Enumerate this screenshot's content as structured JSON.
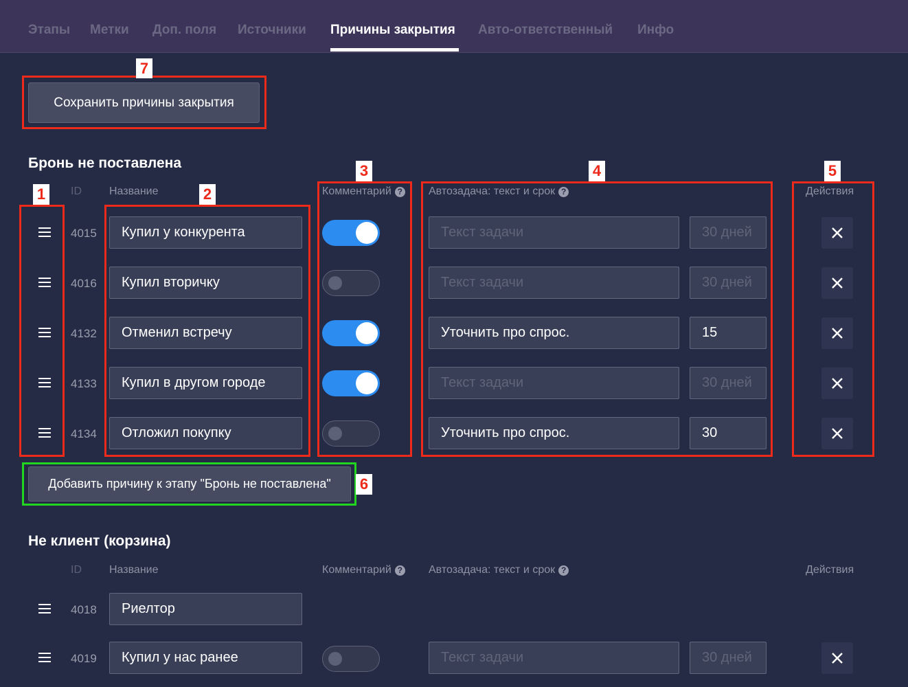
{
  "tabs": [
    {
      "label": "Этапы"
    },
    {
      "label": "Метки"
    },
    {
      "label": "Доп. поля"
    },
    {
      "label": "Источники"
    },
    {
      "label": "Причины закрытия",
      "active": true
    },
    {
      "label": "Авто-ответственный"
    },
    {
      "label": "Инфо"
    }
  ],
  "save_button": "Сохранить причины закрытия",
  "columns": {
    "id": "ID",
    "name": "Название",
    "comment": "Комментарий",
    "autotask": "Автозадача: текст и срок",
    "actions": "Действия",
    "help_glyph": "?"
  },
  "sections": [
    {
      "title": "Бронь не поставлена",
      "rows": [
        {
          "id": "4015",
          "name": "Купил у конкурента",
          "comment": true,
          "task_text": "",
          "task_days": ""
        },
        {
          "id": "4016",
          "name": "Купил вторичку",
          "comment": false,
          "task_text": "",
          "task_days": ""
        },
        {
          "id": "4132",
          "name": "Отменил встречу",
          "comment": true,
          "task_text": "Уточнить про спрос.",
          "task_days": "15"
        },
        {
          "id": "4133",
          "name": "Купил в другом городе",
          "comment": true,
          "task_text": "",
          "task_days": ""
        },
        {
          "id": "4134",
          "name": "Отложил покупку",
          "comment": false,
          "task_text": "Уточнить про спрос.",
          "task_days": "30"
        }
      ],
      "add_button": "Добавить причину к этапу \"Бронь не поставлена\""
    },
    {
      "title": "Не клиент (корзина)",
      "rows": [
        {
          "id": "4018",
          "name": "Риелтор"
        },
        {
          "id": "4019",
          "name": "Купил у нас ранее",
          "comment": false,
          "task_text": "",
          "task_days": ""
        }
      ]
    }
  ],
  "placeholders": {
    "task_text": "Текст задачи",
    "task_days": "30 дней"
  },
  "markers": [
    "1",
    "2",
    "3",
    "4",
    "5",
    "6",
    "7"
  ],
  "colors": {
    "background": "#252b44",
    "nav": "#3d3559",
    "toggle_on": "#2d8cf0",
    "annotation_red": "#ee2a1b",
    "annotation_green": "#21d521"
  }
}
